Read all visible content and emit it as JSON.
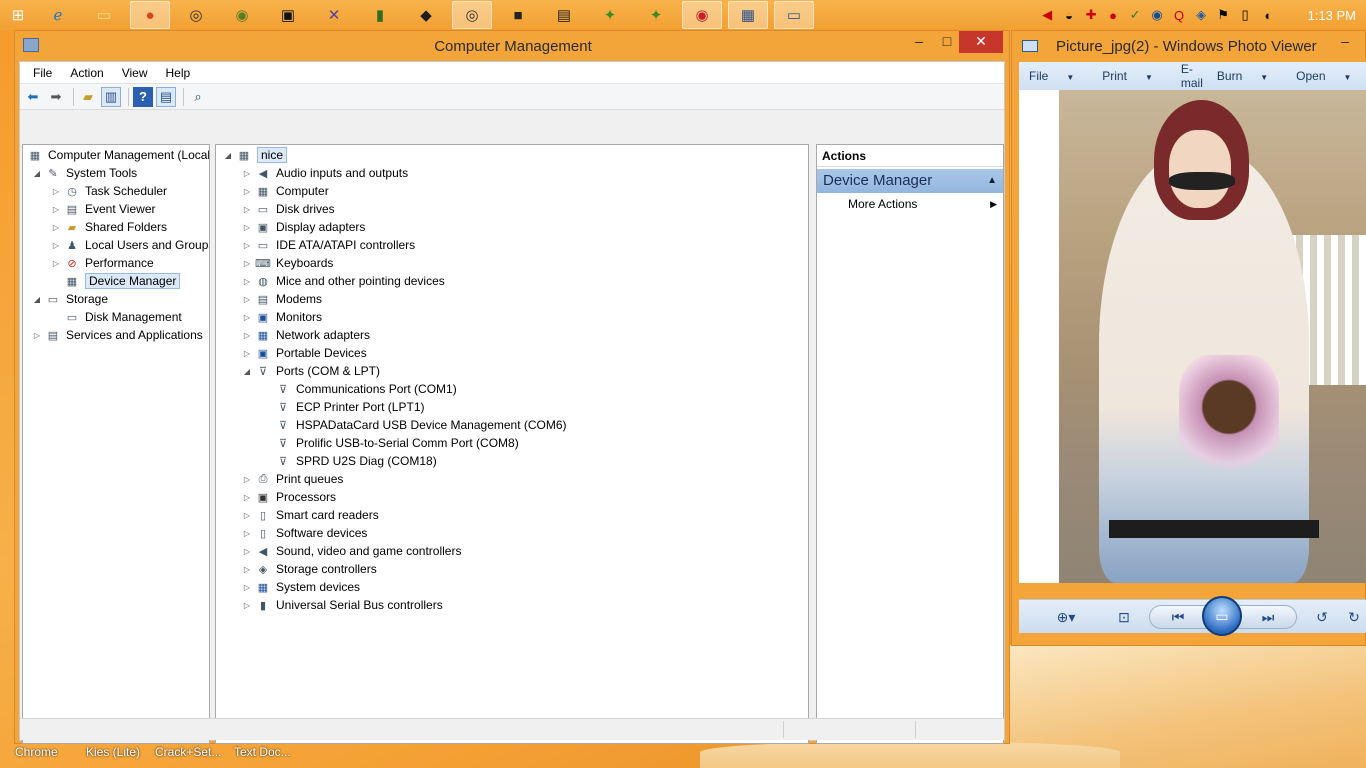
{
  "taskbar": {
    "clock": "1:13 PM"
  },
  "cm": {
    "title": "Computer Management",
    "controls": {
      "minimize": "–",
      "maximize": "□",
      "close": "✕"
    },
    "menu": [
      "File",
      "Action",
      "View",
      "Help"
    ],
    "tree": {
      "root": "Computer Management (Local",
      "system_tools": "System Tools",
      "task_scheduler": "Task Scheduler",
      "event_viewer": "Event Viewer",
      "shared_folders": "Shared Folders",
      "local_users": "Local Users and Groups",
      "performance": "Performance",
      "device_manager": "Device Manager",
      "storage": "Storage",
      "disk_management": "Disk Management",
      "services": "Services and Applications"
    },
    "devices": {
      "root": "nice",
      "categories": [
        "Audio inputs and outputs",
        "Computer",
        "Disk drives",
        "Display adapters",
        "IDE ATA/ATAPI controllers",
        "Keyboards",
        "Mice and other pointing devices",
        "Modems",
        "Monitors",
        "Network adapters",
        "Portable Devices",
        "Ports (COM & LPT)",
        "Print queues",
        "Processors",
        "Smart card readers",
        "Software devices",
        "Sound, video and game controllers",
        "Storage controllers",
        "System devices",
        "Universal Serial Bus controllers"
      ],
      "ports": [
        "Communications Port (COM1)",
        "ECP Printer Port (LPT1)",
        "HSPADataCard USB Device Management (COM6)",
        "Prolific USB-to-Serial Comm Port (COM8)",
        "SPRD U2S Diag (COM18)"
      ]
    },
    "actions": {
      "header": "Actions",
      "section": "Device Manager",
      "more": "More Actions"
    }
  },
  "pv": {
    "title": "Picture_jpg(2) - Windows Photo Viewer",
    "minimize": "–",
    "menu": {
      "file": "File",
      "print": "Print",
      "email": "E-mail",
      "burn": "Burn",
      "open": "Open"
    }
  },
  "desktop": {
    "labels": [
      "Chrome",
      "Kies (Lite)",
      "Crack+Set...",
      "Text Doc..."
    ]
  }
}
